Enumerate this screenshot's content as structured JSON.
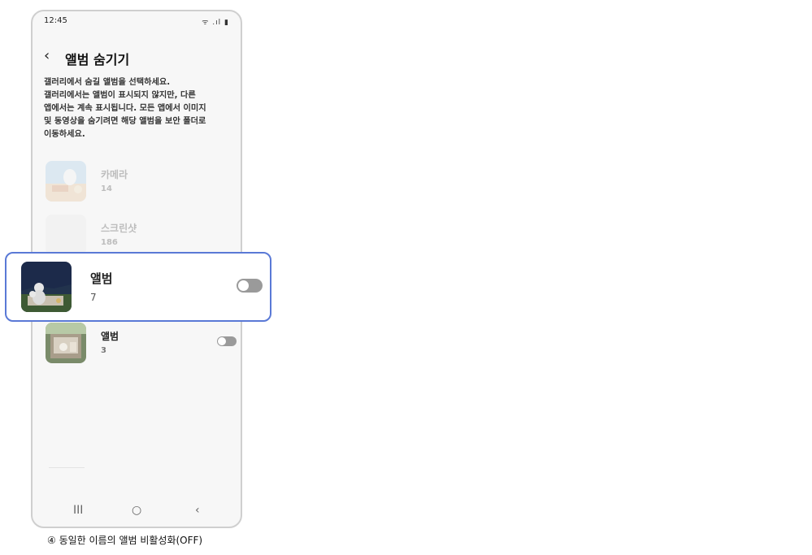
{
  "status_bar": {
    "time": "12:45",
    "icons_text": "ᯤ .ıl ▮"
  },
  "header": {
    "back_icon": "‹",
    "title": "앨범 숨기기"
  },
  "description": {
    "lines": [
      "갤러리에서 숨길 앨범을 선택하세요.",
      "갤러리에서는 앨범이 표시되지 않지만, 다른",
      "앱에서는 계속 표시됩니다. 모든 앱에서 이미지",
      "및 동영상을 숨기려면 해당 앨범을 보안 폴더로",
      "이동하세요."
    ]
  },
  "albums": [
    {
      "name": "카메라",
      "count": "14",
      "thumb_icon": "camera-album-thumbnail"
    },
    {
      "name": "스크린샷",
      "count": "186",
      "thumb_icon": "screenshots-album-thumbnail"
    },
    {
      "name": "앨범",
      "count": "3",
      "thumb_icon": "album-thumbnail",
      "hidden": false
    }
  ],
  "highlight": {
    "name": "앨범",
    "count": "7",
    "hidden": false,
    "thumb_icon": "album-night-thumbnail"
  },
  "nav": {
    "recents": "III",
    "home": "○",
    "back": "‹"
  },
  "caption": "④ 동일한 이름의 앨범 비활성화(OFF)",
  "colors": {
    "accent": "#5a79d6",
    "toggle_off": "#9a9a9a"
  }
}
